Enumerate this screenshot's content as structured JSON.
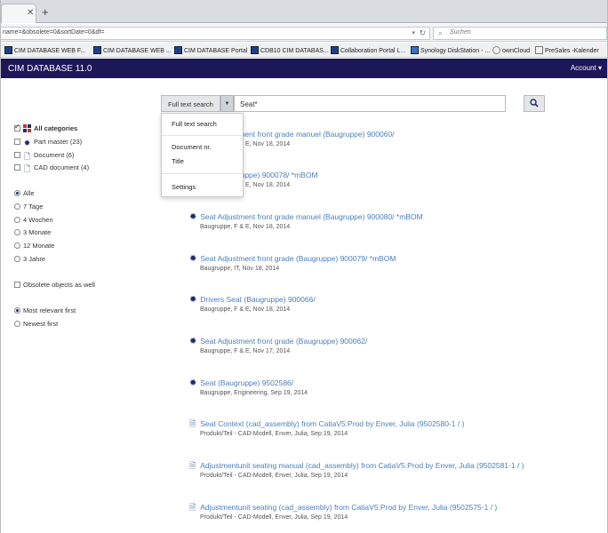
{
  "browser": {
    "url": "name=&obsolete=0&sortDate=0&df=",
    "search_placeholder": "Suchen",
    "bookmarks": [
      "CIM DATABASE WEB F...",
      "CIM DATABASE WEB ...",
      "CIM DATABASE Portal",
      "CDB10 CIM DATABAS...",
      "Collaboration Portal L...",
      "Synology DiskStation - ...",
      "ownCloud",
      "PreSales -Kalender"
    ]
  },
  "app": {
    "title": "CIM DATABASE 11.0",
    "account": "Account"
  },
  "search": {
    "mode_label": "Full text search",
    "query": "Seat*",
    "menu": {
      "full_text": "Full text search",
      "document_nr": "Document nr.",
      "title": "Title",
      "settings": "Settings"
    }
  },
  "filters": {
    "categories": [
      {
        "label": "All categories",
        "checked": true
      },
      {
        "label": "Part master (23)",
        "checked": false
      },
      {
        "label": "Document (6)",
        "checked": false
      },
      {
        "label": "CAD document (4)",
        "checked": false
      }
    ],
    "periods": [
      "Alle",
      "7 Tage",
      "4 Wochen",
      "3 Monate",
      "12 Monate",
      "3 Jahre"
    ],
    "obsolete": "Obsolete objects as well",
    "sort": [
      "Most relevant first",
      "Newest first"
    ]
  },
  "results": [
    {
      "title": "Seat Adjustment front grade manuel (Baugruppe) 900060/",
      "sub": "Baugruppe, F & E, Nov 18, 2014",
      "type": "part"
    },
    {
      "title": "Seat (Baugruppe) 900078/ *mBOM",
      "sub": "Baugruppe, F & E, Nov 18, 2014",
      "type": "part"
    },
    {
      "title": "Seat Adjustment front grade manuel (Baugruppe) 900080/ *mBOM",
      "sub": "Baugruppe, F & E, Nov 18, 2014",
      "type": "part"
    },
    {
      "title": "Seat Adjustment front grade (Baugruppe) 900079/ *mBOM",
      "sub": "Baugruppe, IT, Nov 18, 2014",
      "type": "part"
    },
    {
      "title": "Drivers Seat (Baugruppe) 900066/",
      "sub": "Baugruppe, F & E, Nov 18, 2014",
      "type": "part"
    },
    {
      "title": "Seat Adjustment front grade (Baugruppe) 900062/",
      "sub": "Baugruppe, F & E, Nov 17, 2014",
      "type": "part"
    },
    {
      "title": "Seat (Baugruppe) 9502586/",
      "sub": "Baugruppe, Engineering, Sep 19, 2014",
      "type": "part"
    },
    {
      "title": "Seat Context (cad_assembly) from CatiaV5:Prod by Enver, Julia (9502580-1 / )",
      "sub": "Produkt/Teil - CAD-Modell, Enver, Julia, Sep 19, 2014",
      "type": "cad"
    },
    {
      "title": "Adjustmentunit seating manual (cad_assembly) from CatiaV5:Prod by Enver, Julia (9502581-1 / )",
      "sub": "Produkt/Teil - CAD-Modell, Enver, Julia, Sep 19, 2014",
      "type": "cad"
    },
    {
      "title": "Adjustmentunit seating (cad_assembly) from CatiaV5:Prod by Enver, Julia (9502575-1 / )",
      "sub": "Produkt/Teil - CAD-Modell, Enver, Julia, Sep 19, 2014",
      "type": "cad"
    }
  ]
}
